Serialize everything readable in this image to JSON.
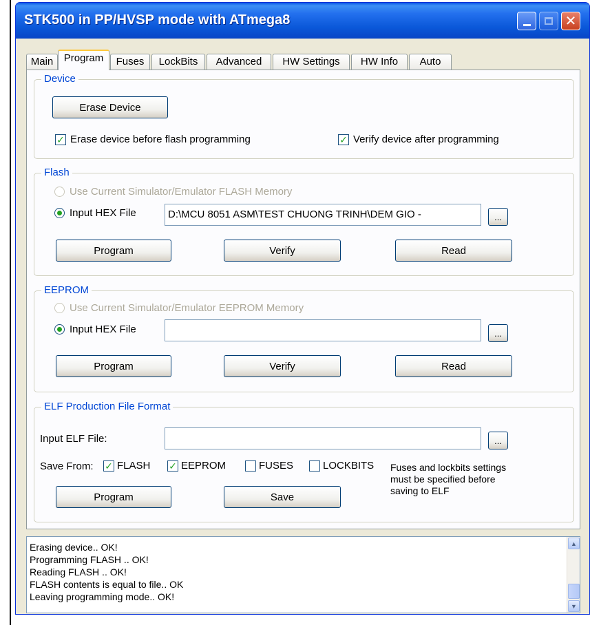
{
  "window": {
    "title": "STK500 in PP/HVSP mode with ATmega8"
  },
  "tabs": [
    {
      "label": "Main"
    },
    {
      "label": "Program"
    },
    {
      "label": "Fuses"
    },
    {
      "label": "LockBits"
    },
    {
      "label": "Advanced"
    },
    {
      "label": "HW Settings"
    },
    {
      "label": "HW Info"
    },
    {
      "label": "Auto"
    }
  ],
  "active_tab": "Program",
  "device": {
    "legend": "Device",
    "erase_button": "Erase Device",
    "erase_before_flash": {
      "label": "Erase device before flash programming",
      "checked": true
    },
    "verify_after": {
      "label": "Verify device after programming",
      "checked": true
    }
  },
  "flash": {
    "legend": "Flash",
    "use_sim_label": "Use Current Simulator/Emulator FLASH Memory",
    "input_hex_label": "Input HEX File",
    "hex_path": "D:\\MCU 8051 ASM\\TEST CHUONG TRINH\\DEM GIO -",
    "browse": "...",
    "program": "Program",
    "verify": "Verify",
    "read": "Read"
  },
  "eeprom": {
    "legend": "EEPROM",
    "use_sim_label": "Use Current Simulator/Emulator EEPROM Memory",
    "input_hex_label": "Input HEX File",
    "hex_path": "",
    "browse": "...",
    "program": "Program",
    "verify": "Verify",
    "read": "Read"
  },
  "elf": {
    "legend": "ELF Production File Format",
    "input_label": "Input ELF File:",
    "input_value": "",
    "browse": "...",
    "save_from_label": "Save From:",
    "options": [
      {
        "label": "FLASH",
        "checked": true
      },
      {
        "label": "EEPROM",
        "checked": true
      },
      {
        "label": "FUSES",
        "checked": false
      },
      {
        "label": "LOCKBITS",
        "checked": false
      }
    ],
    "note_lines": [
      "Fuses and lockbits settings",
      "must be specified before",
      "saving to ELF"
    ],
    "program": "Program",
    "save": "Save"
  },
  "log": [
    "Erasing device.. OK!",
    "Programming FLASH ..      OK!",
    "Reading FLASH ..      OK!",
    "FLASH contents is equal to file.. OK",
    "Leaving programming mode.. OK!"
  ],
  "colors": {
    "accent": "#0046d5",
    "check": "#21a121",
    "titlebar": "#0a57d8"
  }
}
